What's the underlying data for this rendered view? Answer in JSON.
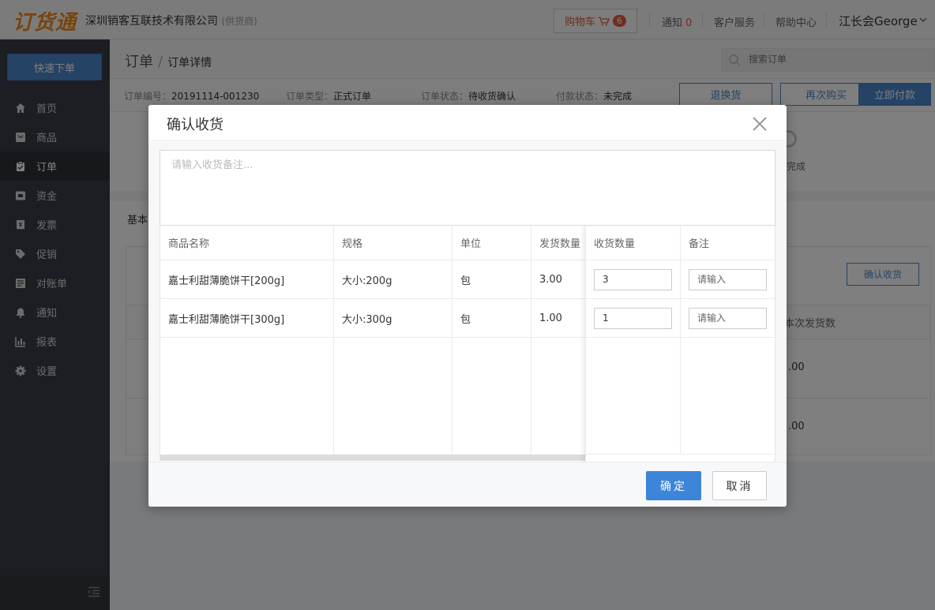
{
  "topbar": {
    "logo": "订货通",
    "company": "深圳销客互联技术有限公司",
    "company_tag": "(供货商)",
    "cart_label": "购物车",
    "cart_count": "6",
    "notice_label": "通知",
    "notice_count": "0",
    "service_label": "客户服务",
    "help_label": "帮助中心",
    "user_name": "江长会George"
  },
  "sidebar": {
    "quick_order": "快速下单",
    "items": [
      {
        "label": "首页",
        "icon": "home-icon"
      },
      {
        "label": "商品",
        "icon": "product-icon"
      },
      {
        "label": "订单",
        "icon": "order-icon"
      },
      {
        "label": "资金",
        "icon": "funds-icon"
      },
      {
        "label": "发票",
        "icon": "invoice-icon"
      },
      {
        "label": "促销",
        "icon": "tag-icon"
      },
      {
        "label": "对账单",
        "icon": "statement-icon"
      },
      {
        "label": "通知",
        "icon": "bell-icon"
      },
      {
        "label": "报表",
        "icon": "chart-icon"
      },
      {
        "label": "设置",
        "icon": "gear-icon"
      }
    ]
  },
  "page": {
    "crumb_root": "订单",
    "crumb_sep": "/",
    "crumb_current": "订单详情",
    "search_placeholder": "搜索订单",
    "order_no_label": "订单编号：",
    "order_no": "20191114-001230",
    "order_type_label": "订单类型：",
    "order_type": "正式订单",
    "order_status_label": "订单状态：",
    "order_status": "待收货确认",
    "pay_status_label": "付款状态：",
    "pay_status": "未完成",
    "btn_return": "退换货",
    "btn_rebuy": "再次购买",
    "btn_pay": "立即付款",
    "step_done": "完成",
    "basic_label": "基本",
    "bg_confirm_btn": "确认收货",
    "bg_col_label": "本次发货数",
    "bg_row1": ".00",
    "bg_row2": ".00"
  },
  "modal": {
    "title": "确认收货",
    "remark_placeholder": "请输入收货备注...",
    "headers": {
      "name": "商品名称",
      "spec": "规格",
      "unit": "单位",
      "ship_qty": "发货数量",
      "recv_qty": "收货数量",
      "note": "备注"
    },
    "rows": [
      {
        "name": "嘉士利甜薄脆饼干[200g]",
        "spec": "大小:200g",
        "unit": "包",
        "ship_qty": "3.00",
        "recv_qty": "3",
        "note_placeholder": "请输入"
      },
      {
        "name": "嘉士利甜薄脆饼干[300g]",
        "spec": "大小:300g",
        "unit": "包",
        "ship_qty": "1.00",
        "recv_qty": "1",
        "note_placeholder": "请输入"
      }
    ],
    "ok_label": "确定",
    "cancel_label": "取消"
  }
}
